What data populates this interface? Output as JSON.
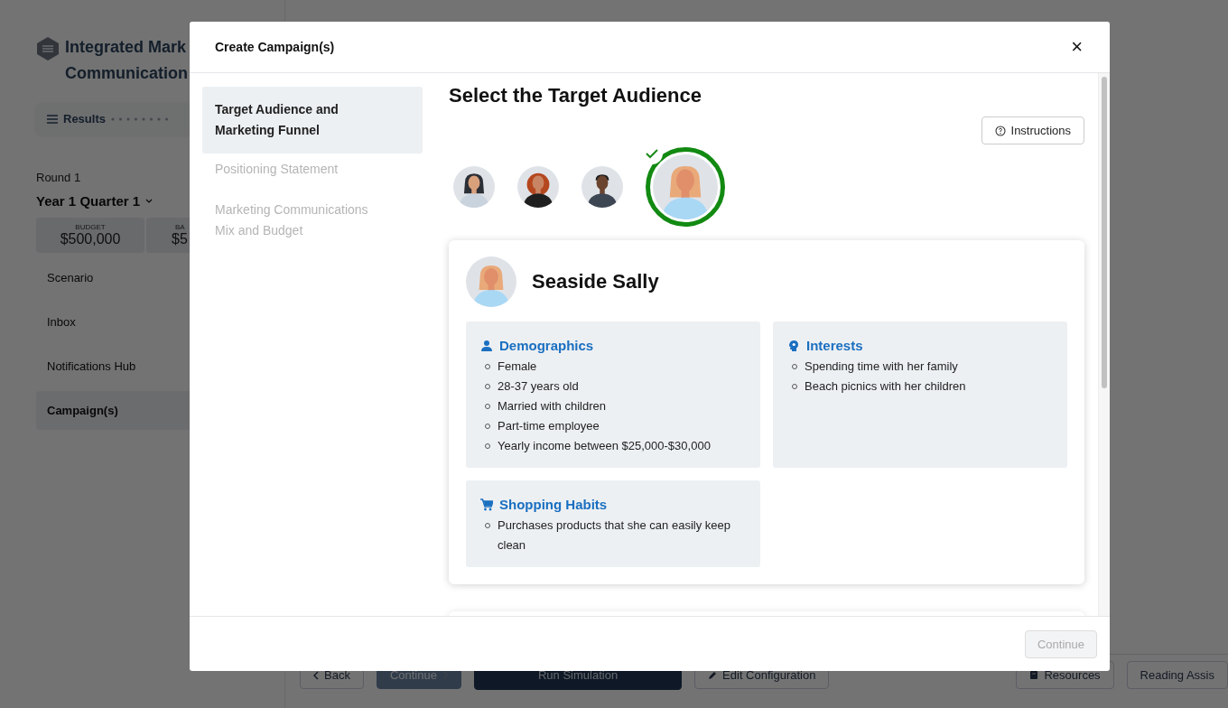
{
  "background": {
    "app_title_lines": [
      "Integrated Mark",
      "Communication"
    ],
    "results_label": "Results",
    "round_label": "Round 1",
    "period": "Year 1 Quarter 1",
    "budget_cards": [
      {
        "label": "BUDGET",
        "value": "$500,000"
      },
      {
        "label": "BA",
        "value": "$5"
      }
    ],
    "nav": [
      {
        "label": "Scenario",
        "selected": false
      },
      {
        "label": "Inbox",
        "selected": false
      },
      {
        "label": "Notifications Hub",
        "selected": false
      },
      {
        "label": "Campaign(s)",
        "selected": true
      }
    ],
    "bottom_buttons": [
      {
        "label": "Back",
        "kind": "back",
        "disabled": false
      },
      {
        "label": "Continue",
        "kind": "next",
        "disabled": true
      },
      {
        "label": "Run Simulation",
        "kind": "primary",
        "disabled": false
      },
      {
        "label": "Edit Configuration",
        "kind": "edit",
        "disabled": false
      },
      {
        "kind": "spacer"
      },
      {
        "label": "Resources",
        "kind": "resources",
        "disabled": false
      },
      {
        "label": "Reading Assis",
        "kind": "plain",
        "disabled": false
      }
    ]
  },
  "modal": {
    "title": "Create Campaign(s)",
    "close": "×",
    "steps": [
      {
        "label": "Target Audience and Marketing Funnel",
        "selected": true,
        "disabled": false
      },
      {
        "label": "Positioning Statement",
        "selected": false,
        "disabled": true
      },
      {
        "label": "Marketing Communications Mix and Budget",
        "selected": false,
        "disabled": true
      }
    ],
    "heading": "Select the Target Audience",
    "instructions_button": "Instructions",
    "personas": [
      {
        "kind": "darkhair",
        "selected": false
      },
      {
        "kind": "redhair",
        "selected": false
      },
      {
        "kind": "man",
        "selected": false
      },
      {
        "kind": "blonde",
        "selected": true
      }
    ],
    "profile": {
      "avatar": {
        "kind": "blonde"
      },
      "name": "Seaside Sally",
      "sections": [
        {
          "kind": "person",
          "title": "Demographics",
          "items": [
            "Female",
            "28-37 years old",
            "Married with children",
            "Part-time employee",
            "Yearly income between $25,000-$30,000"
          ]
        },
        {
          "kind": "bulb",
          "title": "Interests",
          "items": [
            "Spending time with her family",
            "Beach picnics with her children"
          ]
        },
        {
          "kind": "cart",
          "title": "Shopping Habits",
          "items": [
            "Purchases products that she can easily keep clean"
          ]
        }
      ]
    },
    "continue_button": {
      "label": "Continue",
      "disabled": true
    }
  }
}
